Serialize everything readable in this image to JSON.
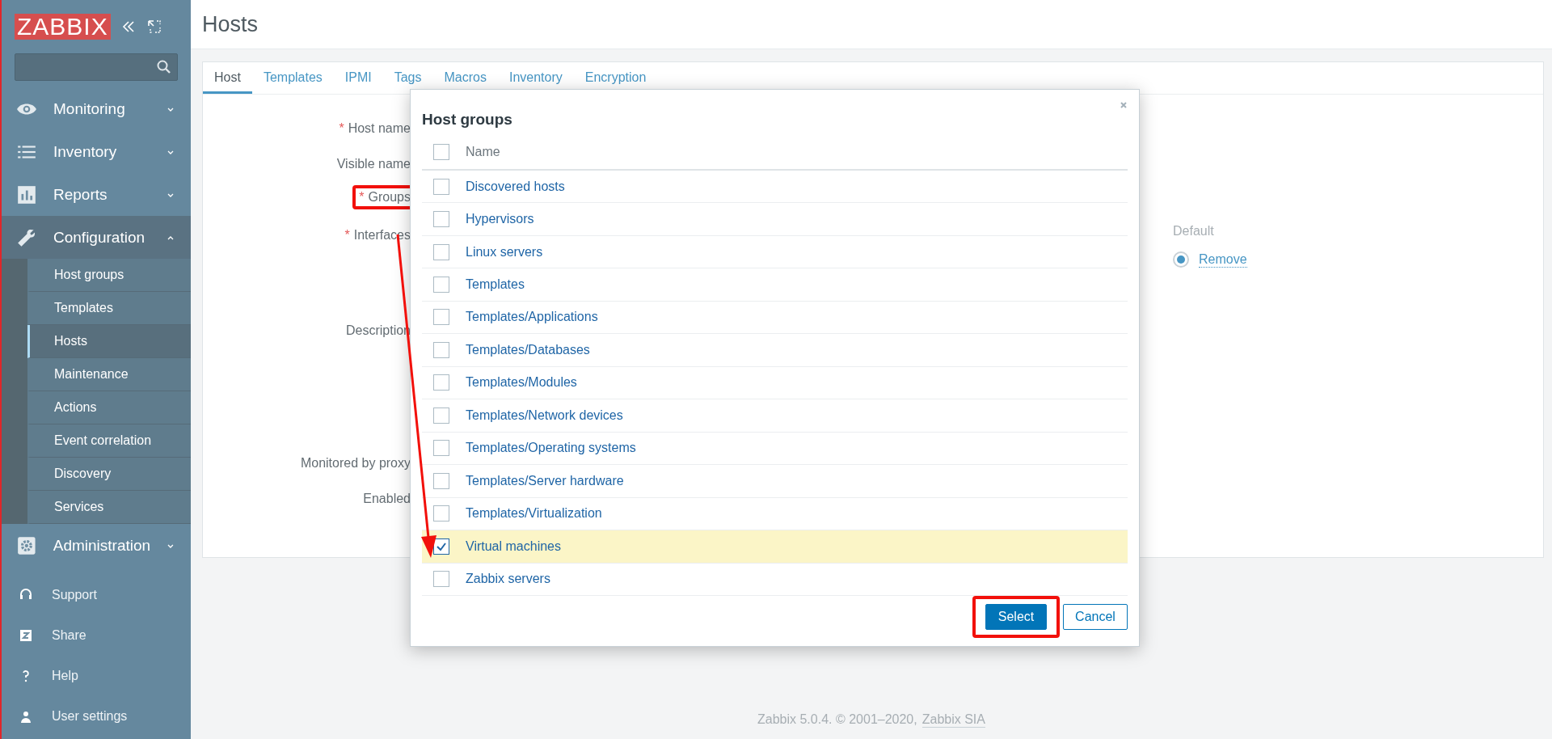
{
  "sidebar": {
    "logo": "ZABBIX",
    "menu": [
      {
        "label": "Monitoring",
        "expanded": false
      },
      {
        "label": "Inventory",
        "expanded": false
      },
      {
        "label": "Reports",
        "expanded": false
      },
      {
        "label": "Configuration",
        "expanded": true,
        "children": [
          {
            "label": "Host groups",
            "selected": false
          },
          {
            "label": "Templates",
            "selected": false
          },
          {
            "label": "Hosts",
            "selected": true
          },
          {
            "label": "Maintenance",
            "selected": false
          },
          {
            "label": "Actions",
            "selected": false
          },
          {
            "label": "Event correlation",
            "selected": false
          },
          {
            "label": "Discovery",
            "selected": false
          },
          {
            "label": "Services",
            "selected": false
          }
        ]
      },
      {
        "label": "Administration",
        "expanded": false
      }
    ],
    "bottom": [
      {
        "label": "Support"
      },
      {
        "label": "Share"
      },
      {
        "label": "Help"
      },
      {
        "label": "User settings"
      }
    ]
  },
  "page_title": "Hosts",
  "tabs": [
    {
      "label": "Host",
      "selected": true
    },
    {
      "label": "Templates",
      "selected": false
    },
    {
      "label": "IPMI",
      "selected": false
    },
    {
      "label": "Tags",
      "selected": false
    },
    {
      "label": "Macros",
      "selected": false
    },
    {
      "label": "Inventory",
      "selected": false
    },
    {
      "label": "Encryption",
      "selected": false
    }
  ],
  "form": [
    {
      "label": "Host name",
      "required_mark": "*"
    },
    {
      "label": "Visible name"
    },
    {
      "label": "Groups",
      "required_mark": "*"
    },
    {
      "label": "Interfaces",
      "required_mark": "*"
    },
    {
      "label": "Description"
    },
    {
      "label": "Monitored by proxy"
    },
    {
      "label": "Enabled"
    }
  ],
  "interface": {
    "default_heading": "Default",
    "default_selected": true,
    "remove_link": "Remove"
  },
  "dialog": {
    "title": "Host groups",
    "column": "Name",
    "all_checked": false,
    "rows": [
      {
        "name": "Discovered hosts",
        "checked": false
      },
      {
        "name": "Hypervisors",
        "checked": false
      },
      {
        "name": "Linux servers",
        "checked": false
      },
      {
        "name": "Templates",
        "checked": false
      },
      {
        "name": "Templates/Applications",
        "checked": false
      },
      {
        "name": "Templates/Databases",
        "checked": false
      },
      {
        "name": "Templates/Modules",
        "checked": false
      },
      {
        "name": "Templates/Network devices",
        "checked": false
      },
      {
        "name": "Templates/Operating systems",
        "checked": false
      },
      {
        "name": "Templates/Server hardware",
        "checked": false
      },
      {
        "name": "Templates/Virtualization",
        "checked": false
      },
      {
        "name": "Virtual machines",
        "checked": true
      },
      {
        "name": "Zabbix servers",
        "checked": false
      }
    ],
    "buttons": [
      "Select",
      "Cancel"
    ]
  },
  "footer": {
    "text": "Zabbix 5.0.4. © 2001–2020,",
    "link": "Zabbix SIA"
  }
}
